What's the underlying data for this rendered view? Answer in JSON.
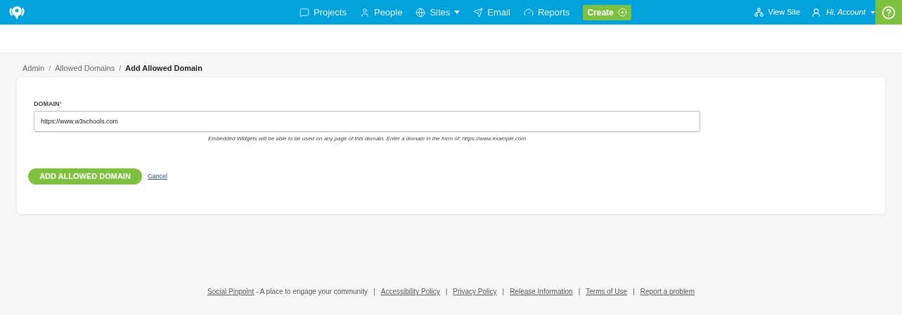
{
  "nav": {
    "items": [
      {
        "label": "Projects",
        "dropdown": false
      },
      {
        "label": "People",
        "dropdown": false
      },
      {
        "label": "Sites",
        "dropdown": true
      },
      {
        "label": "Email",
        "dropdown": false
      },
      {
        "label": "Reports",
        "dropdown": false
      }
    ],
    "create_button": "Create",
    "view_site": "View Site",
    "account": "Hi, Account"
  },
  "breadcrumb": [
    {
      "label": "Admin",
      "current": false
    },
    {
      "label": "Allowed Domains",
      "current": false
    },
    {
      "label": "Add Allowed Domain",
      "current": true
    }
  ],
  "breadcrumb_separator": "/",
  "form": {
    "label": "DOMAIN",
    "required_mark": "*",
    "value": "https://www.w3schools.com",
    "help": "Embedded Widgets will be able to be used on any page of this domain. Enter a domain in the form of: https://www.example.com",
    "submit": "ADD ALLOWED DOMAIN",
    "cancel": "Cancel"
  },
  "footer": {
    "brand_link": "Social Pinpoint",
    "tagline": "- A place to engage your community",
    "links": [
      {
        "separator": "|",
        "label": "Accessibility Policy"
      },
      {
        "separator": "|",
        "label": "Privacy Policy"
      },
      {
        "separator": "|",
        "label": "Release Information"
      },
      {
        "separator": "|",
        "label": "Terms of Use"
      },
      {
        "separator": "|",
        "label": "Report a problem"
      }
    ]
  }
}
